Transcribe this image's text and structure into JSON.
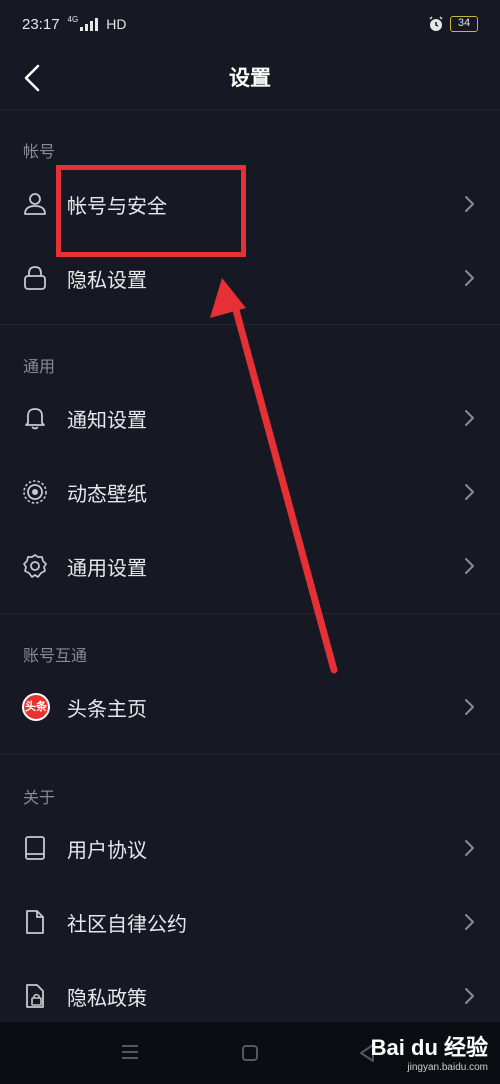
{
  "status_bar": {
    "time": "23:17",
    "network": "HD",
    "signal_tag": "4G",
    "battery": "34"
  },
  "nav": {
    "title": "设置"
  },
  "sections": [
    {
      "header": "帐号",
      "items": [
        {
          "label": "帐号与安全",
          "icon": "user-icon"
        },
        {
          "label": "隐私设置",
          "icon": "lock-icon"
        }
      ]
    },
    {
      "header": "通用",
      "items": [
        {
          "label": "通知设置",
          "icon": "bell-icon"
        },
        {
          "label": "动态壁纸",
          "icon": "wallpaper-icon"
        },
        {
          "label": "通用设置",
          "icon": "gear-icon"
        }
      ]
    },
    {
      "header": "账号互通",
      "items": [
        {
          "label": "头条主页",
          "icon": "toutiao-icon",
          "icon_text": "头条"
        }
      ]
    },
    {
      "header": "关于",
      "items": [
        {
          "label": "用户协议",
          "icon": "book-icon"
        },
        {
          "label": "社区自律公约",
          "icon": "document-icon"
        },
        {
          "label": "隐私政策",
          "icon": "privacy-doc-icon"
        }
      ]
    }
  ],
  "watermark": {
    "brand": "Bai du 经验",
    "url": "jingyan.baidu.com"
  },
  "colors": {
    "background": "#161823",
    "annotation": "#e53036",
    "secondary_text": "#8a8b92"
  }
}
